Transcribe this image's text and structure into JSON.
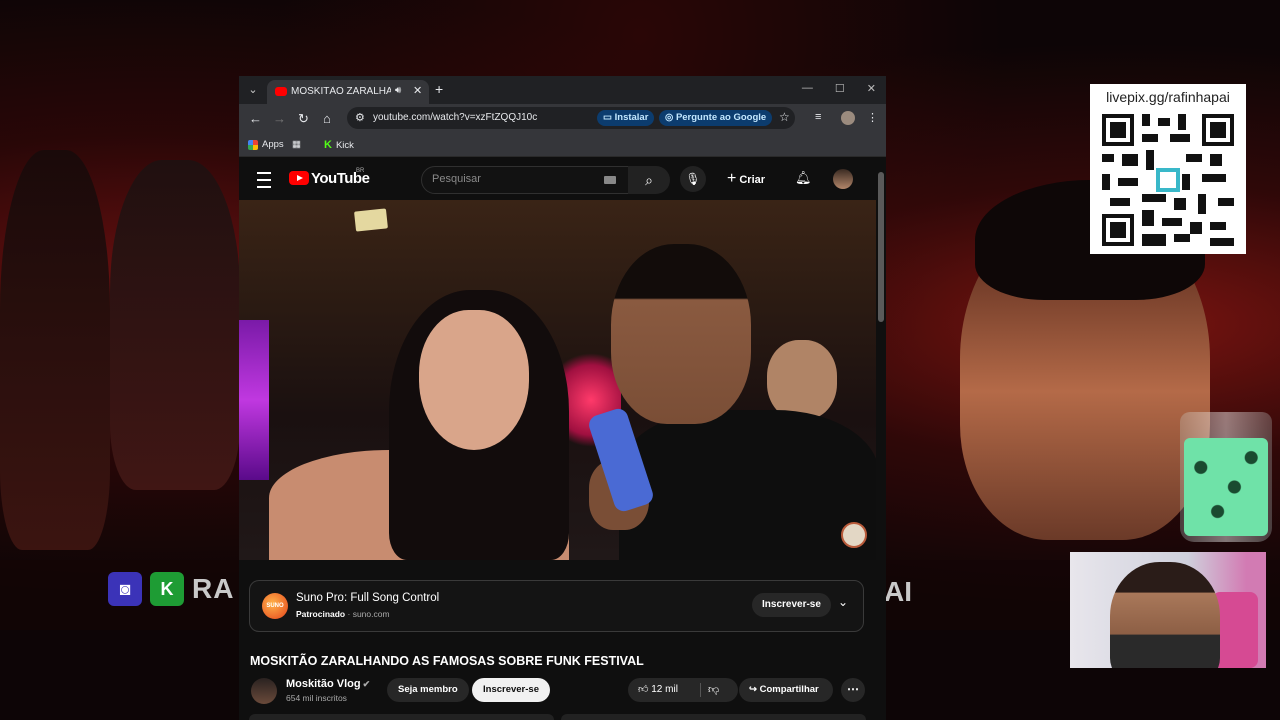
{
  "overlay": {
    "qr_label": "livepix.gg/rafinhapai",
    "brand_left": "RA",
    "brand_right": "AI"
  },
  "browser": {
    "tab_title": "MOSKITÃO ZARALHANDO AS FAMOSAS SOBRE FUNK FESTIVAL",
    "url": "youtube.com/watch?v=xzFtZQQJ10c",
    "install_chip": "Instalar",
    "ask_google_chip": "Pergunte ao Google",
    "bookmarks": [
      {
        "label": "Apps"
      },
      {
        "label": "Kick"
      }
    ]
  },
  "youtube": {
    "logo_text": "YouTube",
    "region": "BR",
    "search_placeholder": "Pesquisar",
    "create_label": "Criar",
    "ad": {
      "logo_text": "SUNO",
      "title": "Suno Pro: Full Song Control",
      "sponsored": "Patrocinado",
      "domain": "suno.com",
      "subscribe": "Inscrever-se"
    },
    "video_title": "MOSKITÃO ZARALHANDO AS FAMOSAS SOBRE FUNK FESTIVAL",
    "channel": {
      "name": "Moskitão Vlog",
      "subscribers": "654 mil inscritos",
      "member_label": "Seja membro",
      "subscribe_label": "Inscrever-se"
    },
    "likes": "12 mil",
    "share_label": "Compartilhar"
  }
}
